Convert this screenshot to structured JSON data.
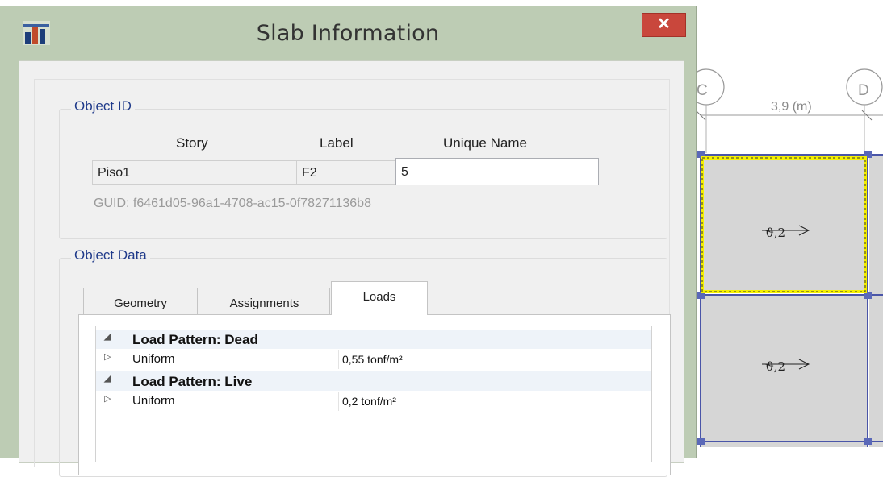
{
  "window": {
    "title": "Slab Information",
    "close_label": "✕"
  },
  "object_id": {
    "legend": "Object ID",
    "headers": {
      "story": "Story",
      "label": "Label",
      "unique_name": "Unique Name"
    },
    "values": {
      "story": "Piso1",
      "label": "F2",
      "unique_name": "5"
    },
    "guid": "GUID: f6461d05-96a1-4708-ac15-0f78271136b8"
  },
  "object_data": {
    "legend": "Object Data",
    "tabs": [
      {
        "label": "Geometry",
        "active": false
      },
      {
        "label": "Assignments",
        "active": false
      },
      {
        "label": "Loads",
        "active": true
      }
    ],
    "load_patterns": [
      {
        "category": "Load Pattern: Dead",
        "items": [
          {
            "name": "Uniform",
            "value": "0,55 tonf/m²"
          }
        ]
      },
      {
        "category": "Load Pattern: Live",
        "items": [
          {
            "name": "Uniform",
            "value": "0,2 tonf/m²"
          }
        ]
      }
    ]
  },
  "plan": {
    "grid_label_c": "C",
    "grid_label_d": "D",
    "dimension": "3,9 (m)",
    "slab_labels": [
      "ϑ,2",
      "ϑ,2"
    ],
    "selection_color": "#f5f000",
    "frame_color": "#4a55a8"
  }
}
